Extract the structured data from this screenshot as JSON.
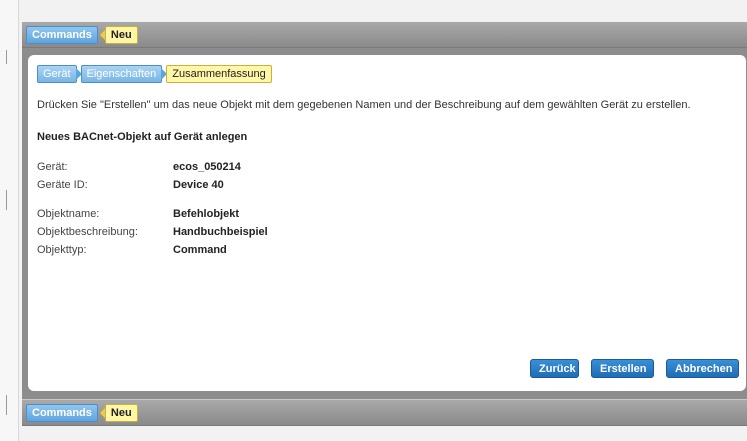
{
  "top_bar": {
    "commands": "Commands",
    "neu": "Neu"
  },
  "bottom_bar": {
    "commands": "Commands",
    "neu": "Neu"
  },
  "wizard": {
    "steps": [
      "Gerät",
      "Eigenschaften",
      "Zusammenfassung"
    ]
  },
  "intro_text": "Drücken Sie \"Erstellen\" um das neue Objekt mit dem gegebenen Namen und der Beschreibung auf dem gewählten Gerät zu erstellen.",
  "section_title": "Neues BACnet-Objekt auf Gerät anlegen",
  "device": {
    "geraet_label": "Gerät:",
    "geraet_value": "ecos_050214",
    "id_label": "Geräte ID:",
    "id_value": "Device 40"
  },
  "object": {
    "name_label": "Objektname:",
    "name_value": "Befehlobjekt",
    "desc_label": "Objektbeschreibung:",
    "desc_value": "Handbuchbeispiel",
    "type_label": "Objekttyp:",
    "type_value": "Command"
  },
  "buttons": {
    "back": "Zurück",
    "create": "Erstellen",
    "cancel": "Abbrechen"
  },
  "colors": {
    "accent_blue": "#2b7fcb",
    "breadcrumb_blue": "#6aaee3",
    "breadcrumb_yellow": "#fff6a8",
    "frame_gray": "#8d8d8d"
  }
}
